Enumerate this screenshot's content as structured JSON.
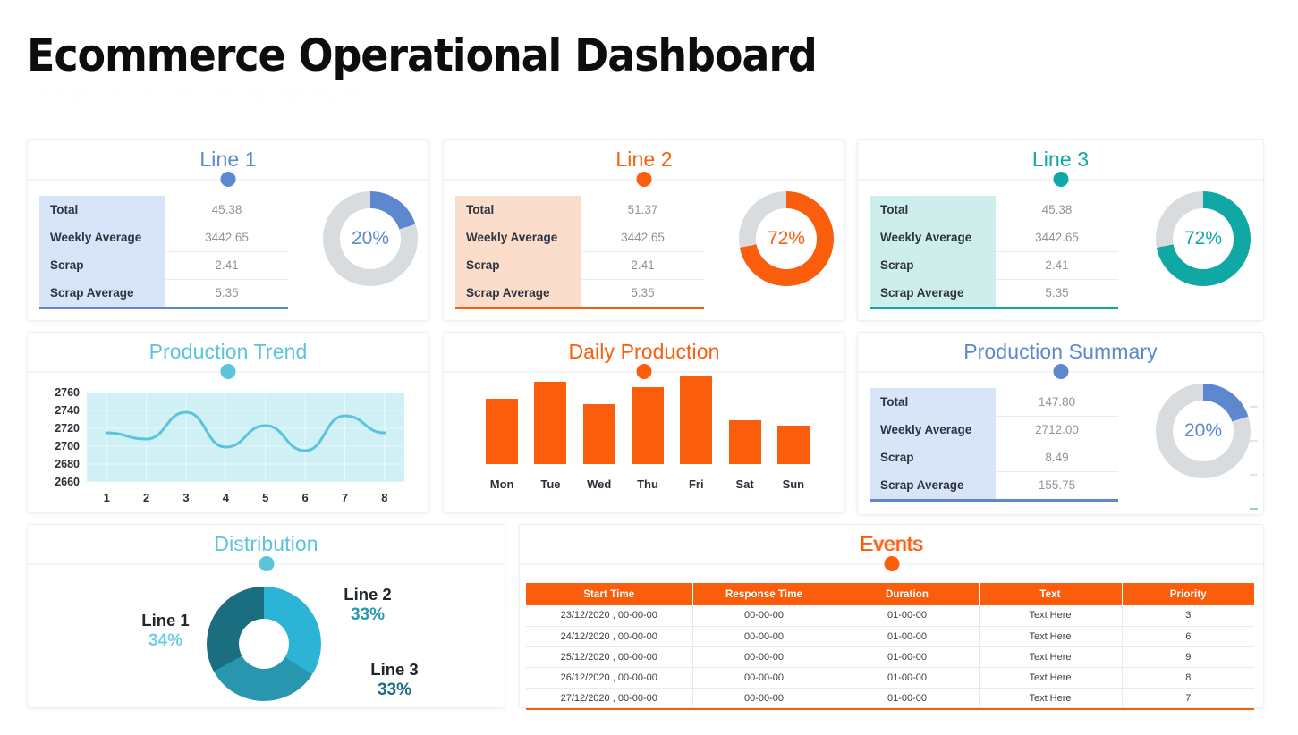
{
  "header": {
    "title": "Ecommerce Operational Dashboard",
    "subtitle": "Lorem ipsum dolor sit amet, consectetur adipiscing elit"
  },
  "colors": {
    "blue": "#5d87ce",
    "orange": "#fa5d0c",
    "teal": "#0fa8a4",
    "cyan": "#5bc4da",
    "track": "#d9dcdf",
    "dist1": "#2cb4d6",
    "dist2": "#2896ae",
    "dist3": "#1a6e80"
  },
  "metric_labels": [
    "Total",
    "Weekly Average",
    "Scrap",
    "Scrap Average"
  ],
  "cards": {
    "line1": {
      "title": "Line 1",
      "accent": "#5d87ce",
      "tint": "#d8e4f8",
      "values": [
        "45.38",
        "3442.65",
        "2.41",
        "5.35"
      ],
      "gauge_pct": 20,
      "gauge_label": "20%"
    },
    "line2": {
      "title": "Line 2",
      "accent": "#fa5d0c",
      "tint": "#fbddcc",
      "values": [
        "51.37",
        "3442.65",
        "2.41",
        "5.35"
      ],
      "gauge_pct": 72,
      "gauge_label": "72%"
    },
    "line3": {
      "title": "Line 3",
      "accent": "#0fa8a4",
      "tint": "#cdeeeb",
      "values": [
        "45.38",
        "3442.65",
        "2.41",
        "5.35"
      ],
      "gauge_pct": 72,
      "gauge_label": "72%"
    },
    "summary": {
      "title": "Production Summary",
      "accent": "#5d87ce",
      "tint": "#d8e4f8",
      "values": [
        "147.80",
        "2712.00",
        "8.49",
        "155.75"
      ],
      "gauge_pct": 20,
      "gauge_label": "20%"
    },
    "trend": {
      "title": "Production Trend",
      "accent": "#5bc4da"
    },
    "daily": {
      "title": "Daily Production",
      "accent": "#fa5d0c"
    },
    "distribution": {
      "title": "Distribution",
      "accent": "#5bc4da"
    },
    "events": {
      "title": "Events",
      "accent": "#fa5d0c"
    }
  },
  "chart_data": [
    {
      "type": "line",
      "title": "Production Trend",
      "x": [
        1,
        2,
        3,
        4,
        5,
        6,
        7,
        8
      ],
      "values": [
        2715,
        2708,
        2738,
        2699,
        2723,
        2695,
        2734,
        2715
      ],
      "xlabel": "",
      "ylabel": "",
      "yticks": [
        2660,
        2680,
        2700,
        2720,
        2740,
        2760
      ],
      "ylim": [
        2660,
        2760
      ],
      "grid": true,
      "legend": "none",
      "line_color": "#5bc4da",
      "plot_bg": "#cff0f5"
    },
    {
      "type": "bar",
      "title": "Daily Production",
      "categories": [
        "Mon",
        "Tue",
        "Wed",
        "Thu",
        "Fri",
        "Sat",
        "Sun"
      ],
      "values": [
        68,
        85,
        62,
        80,
        92,
        45,
        40
      ],
      "xlabel": "",
      "ylabel": "",
      "ylim": [
        0,
        100
      ],
      "grid": false,
      "legend": "none",
      "bar_color": "#fa5d0c"
    },
    {
      "type": "pie",
      "title": "Distribution",
      "labels": [
        "Line 1",
        "Line 2",
        "Line 3"
      ],
      "values": [
        34,
        33,
        33
      ],
      "display_values": [
        "34%",
        "33%",
        "33%"
      ],
      "colors": [
        "#2cb4d6",
        "#2896ae",
        "#1a6e80"
      ],
      "legend": "around",
      "label_colors": [
        "#74cfe3",
        "#2896ae",
        "#1a6e80"
      ]
    },
    {
      "type": "pie",
      "title": "Line 1 Gauge",
      "labels": [
        "value",
        "remainder"
      ],
      "values": [
        20,
        80
      ],
      "colors": [
        "#5d87ce",
        "#d9dcdf"
      ]
    },
    {
      "type": "pie",
      "title": "Line 2 Gauge",
      "labels": [
        "value",
        "remainder"
      ],
      "values": [
        72,
        28
      ],
      "colors": [
        "#fa5d0c",
        "#d9dcdf"
      ]
    },
    {
      "type": "pie",
      "title": "Line 3 Gauge",
      "labels": [
        "value",
        "remainder"
      ],
      "values": [
        72,
        28
      ],
      "colors": [
        "#0fa8a4",
        "#d9dcdf"
      ]
    },
    {
      "type": "pie",
      "title": "Production Summary Gauge",
      "labels": [
        "value",
        "remainder"
      ],
      "values": [
        20,
        80
      ],
      "colors": [
        "#5d87ce",
        "#d9dcdf"
      ]
    },
    {
      "type": "table",
      "title": "Events",
      "columns": [
        "Start Time",
        "Response Time",
        "Duration",
        "Text",
        "Priority"
      ],
      "rows": [
        [
          "23/12/2020 , 00-00-00",
          "00-00-00",
          "01-00-00",
          "Text Here",
          "3"
        ],
        [
          "24/12/2020 , 00-00-00",
          "00-00-00",
          "01-00-00",
          "Text Here",
          "6"
        ],
        [
          "25/12/2020 , 00-00-00",
          "00-00-00",
          "01-00-00",
          "Text Here",
          "9"
        ],
        [
          "26/12/2020 , 00-00-00",
          "00-00-00",
          "01-00-00",
          "Text Here",
          "8"
        ],
        [
          "27/12/2020 , 00-00-00",
          "00-00-00",
          "01-00-00",
          "Text Here",
          "7"
        ]
      ]
    }
  ]
}
